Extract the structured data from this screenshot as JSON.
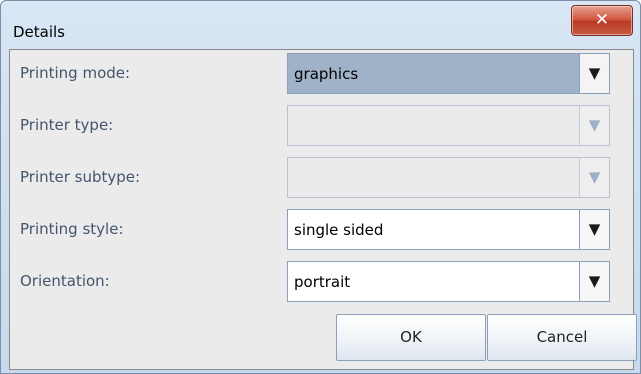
{
  "window": {
    "title": "Details",
    "close_glyph": "✕"
  },
  "fields": [
    {
      "label": "Printing mode:",
      "value": "graphics",
      "state": "focused"
    },
    {
      "label": "Printer type:",
      "value": "",
      "state": "disabled"
    },
    {
      "label": "Printer subtype:",
      "value": "",
      "state": "disabled"
    },
    {
      "label": "Printing style:",
      "value": "single sided",
      "state": "normal"
    },
    {
      "label": "Orientation:",
      "value": "portrait",
      "state": "normal"
    }
  ],
  "arrow_glyph": "▼",
  "buttons": {
    "ok": "OK",
    "cancel": "Cancel"
  },
  "colors": {
    "selected_field": "#9fb2c8",
    "label_text": "#44556b",
    "close_button": "#c8503a"
  }
}
